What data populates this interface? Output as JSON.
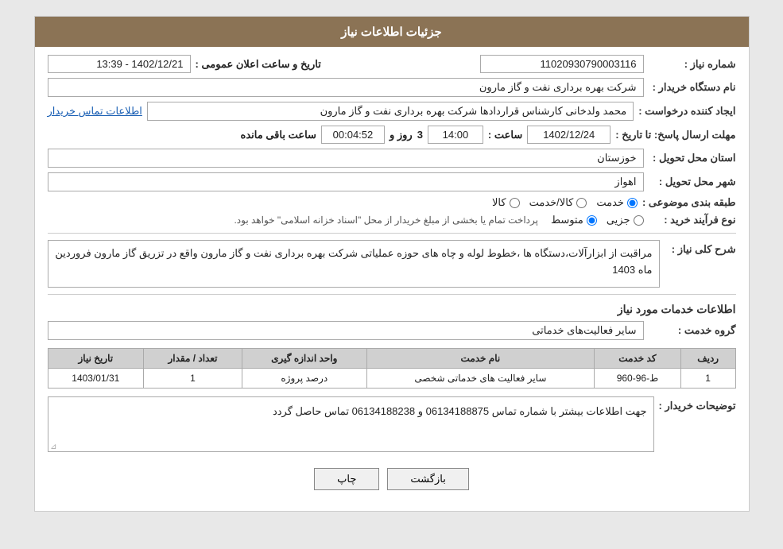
{
  "header": {
    "title": "جزئیات اطلاعات نیاز"
  },
  "fields": {
    "need_number_label": "شماره نیاز :",
    "need_number_value": "11020930790003116",
    "buyer_org_label": "نام دستگاه خریدار :",
    "buyer_org_value": "شرکت بهره برداری نفت و گاز مارون",
    "creator_label": "ایجاد کننده درخواست :",
    "creator_value": "محمد ولدخانی کارشناس قراردادها شرکت بهره برداری نفت و گاز مارون",
    "creator_link": "اطلاعات تماس خریدار",
    "deadline_label": "مهلت ارسال پاسخ: تا تاریخ :",
    "deadline_date": "1402/12/24",
    "deadline_time_label": "ساعت :",
    "deadline_time": "14:00",
    "deadline_days_label": "روز و",
    "deadline_days": "3",
    "deadline_remaining_label": "ساعت باقی مانده",
    "deadline_remaining": "00:04:52",
    "announce_label": "تاریخ و ساعت اعلان عمومی :",
    "announce_value": "1402/12/21 - 13:39",
    "province_label": "استان محل تحویل :",
    "province_value": "خوزستان",
    "city_label": "شهر محل تحویل :",
    "city_value": "اهواز",
    "category_label": "طبقه بندی موضوعی :",
    "category_kala": "کالا",
    "category_khadamat": "خدمت",
    "category_kala_khadamat": "کالا/خدمت",
    "category_selected": "khadamat",
    "process_label": "نوع فرآیند خرید :",
    "process_jozvi": "جزیی",
    "process_motevaset": "متوسط",
    "process_note": "پرداخت تمام یا بخشی از مبلغ خریدار از محل \"اسناد خزانه اسلامی\" خواهد بود.",
    "description_section_title": "شرح کلی نیاز :",
    "description_value": "مراقبت از ابزارآلات،دستگاه ها ،خطوط لوله و چاه های حوزه عملیاتی شرکت بهره برداری نفت و گاز مارون واقع در تزریق گاز مارون فروردین ماه 1403",
    "services_section_title": "اطلاعات خدمات مورد نیاز",
    "service_group_label": "گروه خدمت :",
    "service_group_value": "سایر فعالیت‌های خدماتی",
    "table": {
      "headers": [
        "ردیف",
        "کد خدمت",
        "نام خدمت",
        "واحد اندازه گیری",
        "تعداد / مقدار",
        "تاریخ نیاز"
      ],
      "rows": [
        {
          "row": "1",
          "code": "ط-96-960",
          "name": "سایر فعالیت های خدماتی شخصی",
          "unit": "درصد پروژه",
          "count": "1",
          "date": "1403/01/31"
        }
      ]
    },
    "buyer_notes_label": "توضیحات خریدار :",
    "buyer_notes_value": "جهت اطلاعات بیشتر با شماره تماس 06134188875 و 06134188238 تماس حاصل گردد"
  },
  "buttons": {
    "print_label": "چاپ",
    "back_label": "بازگشت"
  }
}
